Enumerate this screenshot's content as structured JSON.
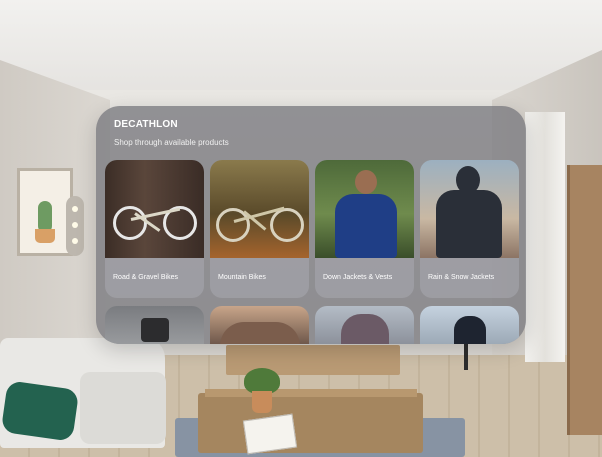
{
  "app": {
    "brand": "DECATHLON",
    "subtitle": "Shop through available products"
  },
  "products": [
    {
      "label": "Road & Gravel Bikes",
      "image_icon": "road-bike-image"
    },
    {
      "label": "Mountain Bikes",
      "image_icon": "mountain-bike-image"
    },
    {
      "label": "Down Jackets & Vests",
      "image_icon": "down-jacket-image"
    },
    {
      "label": "Rain & Snow Jackets",
      "image_icon": "rain-jacket-image"
    }
  ],
  "second_row": [
    {
      "image_icon": "product-image"
    },
    {
      "image_icon": "product-image"
    },
    {
      "image_icon": "product-image"
    },
    {
      "image_icon": "product-image"
    }
  ],
  "colors": {
    "window_glass": "#78787e",
    "text": "#ffffff",
    "down_jacket_blue": "#1f3e86",
    "rain_jacket_dark": "#2a2f38"
  }
}
